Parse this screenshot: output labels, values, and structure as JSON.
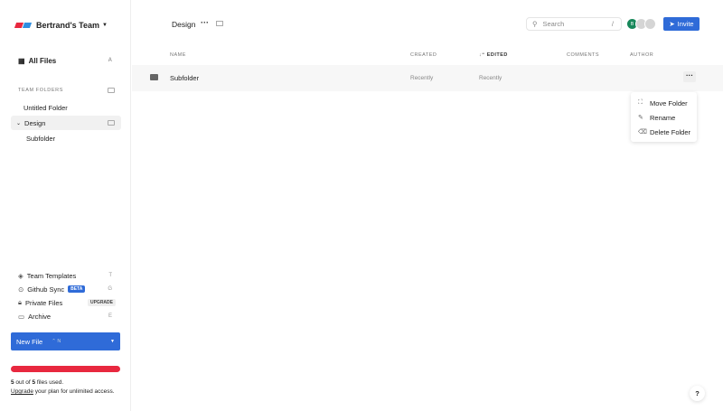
{
  "sidebar": {
    "team_name": "Bertrand's Team",
    "all_files": "All Files",
    "all_files_key": "A",
    "team_folders_label": "TEAM FOLDERS",
    "folders": [
      {
        "label": "Untitled Folder"
      },
      {
        "label": "Design"
      },
      {
        "label": "Subfolder"
      }
    ],
    "team_templates": "Team Templates",
    "team_templates_key": "T",
    "github_sync": "Github Sync",
    "beta": "BETA",
    "github_key": "G",
    "private_files": "Private Files",
    "upgrade_badge": "UPGRADE",
    "archive": "Archive",
    "archive_key": "E",
    "new_file": "New File",
    "new_file_shortcut": "N",
    "usage_used": "5",
    "usage_total": "5",
    "usage_fraction": 1.0,
    "usage_mid": " out of ",
    "usage_end": " files used.",
    "upgrade_link": "Upgrade",
    "upgrade_text": " your plan for unlimited access."
  },
  "header": {
    "title": "Design",
    "search_placeholder": "Search",
    "search_shortcut": "/",
    "avatar_initial": "B",
    "invite": "Invite"
  },
  "table": {
    "columns": {
      "name": "NAME",
      "created": "CREATED",
      "edited": "EDITED",
      "comments": "COMMENTS",
      "author": "AUTHOR"
    },
    "rows": [
      {
        "name": "Subfolder",
        "created": "Recently",
        "edited": "Recently"
      }
    ]
  },
  "context_menu": {
    "items": [
      "Move Folder",
      "Rename",
      "Delete Folder"
    ]
  },
  "help": "?"
}
